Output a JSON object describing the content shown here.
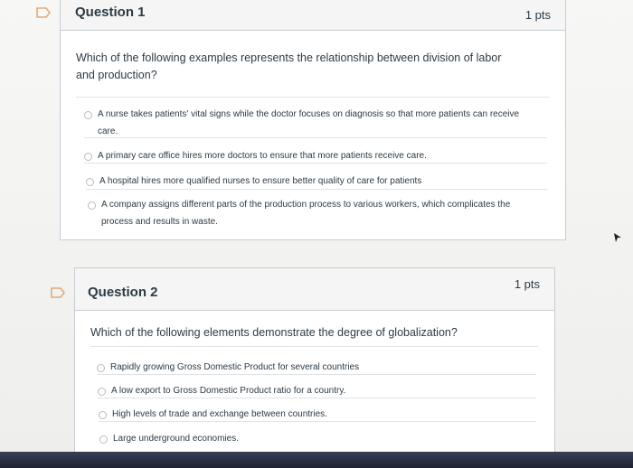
{
  "q1": {
    "title": "Question 1",
    "points": "1 pts",
    "text": "Which of the following examples represents the relationship between division of labor and production?",
    "answers": [
      "A nurse takes patients' vital signs while the doctor focuses on diagnosis so that more patients can receive care.",
      "A primary care office hires more doctors to ensure that more patients receive care.",
      "A hospital hires more qualified nurses to ensure better quality of care for patients",
      "A company assigns different parts of the production process to various workers, which complicates the process and results in waste."
    ]
  },
  "q2": {
    "title": "Question 2",
    "points": "1 pts",
    "text": "Which of the following elements demonstrate the degree of globalization?",
    "answers": [
      "Rapidly growing Gross Domestic Product for several countries",
      "A low export to Gross Domestic Product ratio for a country.",
      "High levels of trade and exchange between countries.",
      "Large underground economies."
    ]
  },
  "colors": {
    "flag_stroke": "#e0a87a",
    "border": "#c7cdd1",
    "text": "#2d3b45"
  },
  "icons": {
    "flag": "flag-question-icon",
    "radio": "radio-button",
    "cursor": "mouse-pointer-icon"
  }
}
